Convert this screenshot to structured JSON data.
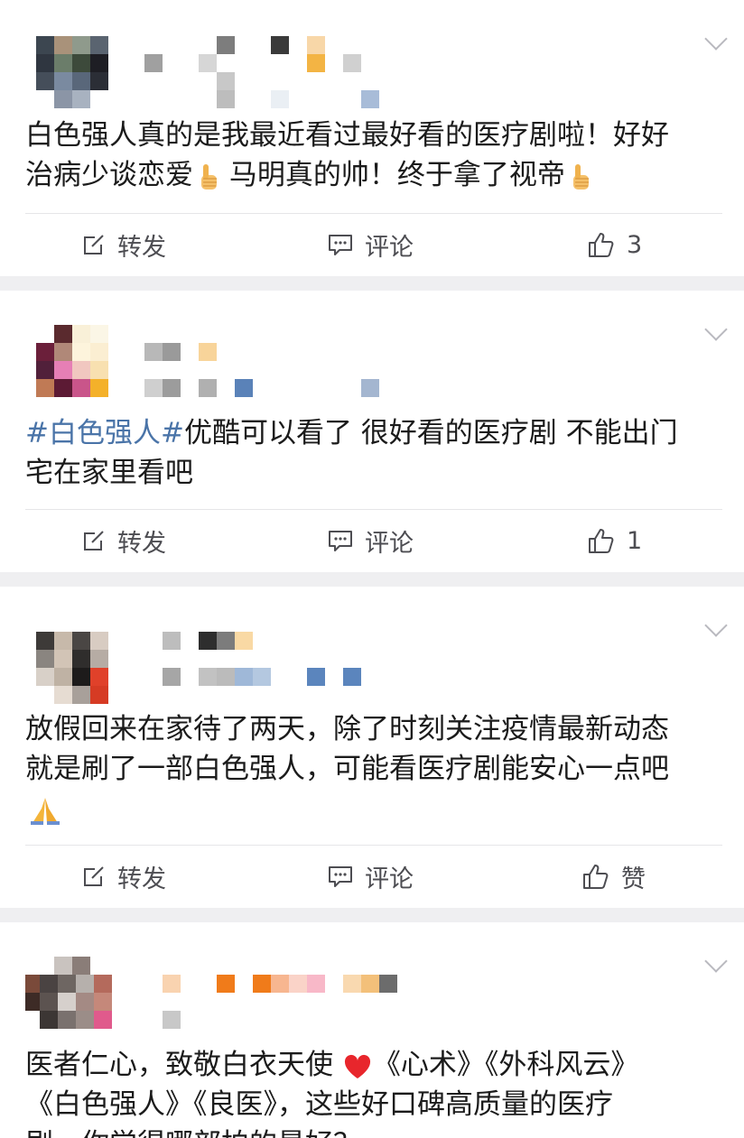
{
  "feed": {
    "posts": [
      {
        "content_parts": [
          "白色强人真的是我最近看过最好看的医疗剧啦！好好\n治病少谈恋爱",
          "马明真的帅！终于拿了视帝"
        ],
        "repost_label": "转发",
        "comment_label": "评论",
        "like_count": "3"
      },
      {
        "tag": "#白色强人#",
        "content": "优酷可以看了 很好看的医疗剧 不能出门\n宅在家里看吧",
        "repost_label": "转发",
        "comment_label": "评论",
        "like_count": "1"
      },
      {
        "content": "放假回来在家待了两天，除了时刻关注疫情最新动态\n就是刷了一部白色强人，可能看医疗剧能安心一点吧",
        "repost_label": "转发",
        "comment_label": "评论",
        "like_label": "赞"
      },
      {
        "content_line1_a": "医者仁心，致敬白衣天使",
        "content_line1_b": "《心术》《外科风云》",
        "content_line2": "《白色强人》《良医》，这些好口碑高质量的医疗",
        "content_line3": "剧，你觉得哪部拍的最好？"
      }
    ]
  },
  "colors": {
    "tag": "#4a74a8",
    "text": "#1b1b1b",
    "action": "#4d4d52",
    "background": "#efeff1"
  },
  "icons": [
    "chevron-down-icon",
    "repost-icon",
    "comment-icon",
    "thumbs-up-icon",
    "thumbs-up-emoji",
    "pray-emoji",
    "heart-emoji"
  ]
}
